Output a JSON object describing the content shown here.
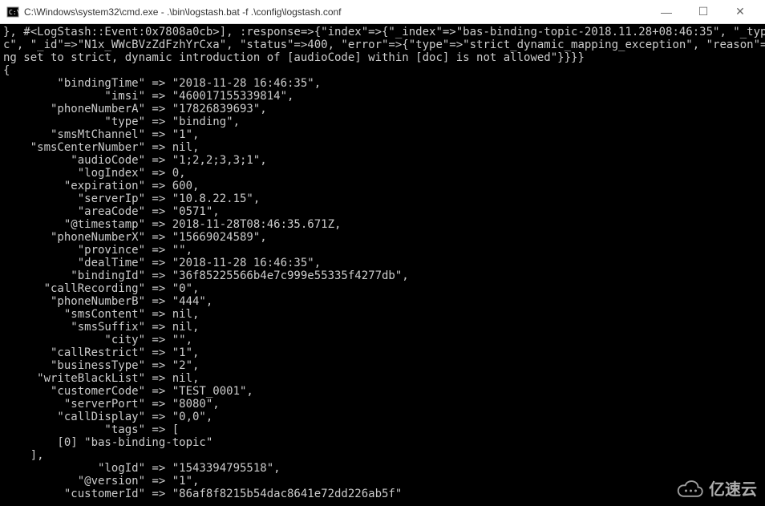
{
  "window": {
    "title": "C:\\Windows\\system32\\cmd.exe - .\\bin\\logstash.bat  -f .\\config\\logstash.conf",
    "minimize": "—",
    "maximize": "☐",
    "close": "✕"
  },
  "header_lines": [
    "}, #<LogStash::Event:0x7808a0cb>], :response=>{\"index\"=>{\"_index\"=>\"bas-binding-topic-2018.11.28+08:46:35\", \"_type\"=>\"do",
    "c\", \"_id\"=>\"N1x_WWcBVzZdFzhYrCxa\", \"status\"=>400, \"error\"=>{\"type\"=>\"strict_dynamic_mapping_exception\", \"reason\"=>\"mappi",
    "ng set to strict, dynamic introduction of [audioCode] within [doc] is not allowed\"}}}}",
    "{"
  ],
  "fields": [
    {
      "key": "\"bindingTime\"",
      "value": "\"2018-11-28 16:46:35\","
    },
    {
      "key": "\"imsi\"",
      "value": "\"460017155339814\","
    },
    {
      "key": "\"phoneNumberA\"",
      "value": "\"17826839693\","
    },
    {
      "key": "\"type\"",
      "value": "\"binding\","
    },
    {
      "key": "\"smsMtChannel\"",
      "value": "\"1\","
    },
    {
      "key": "\"smsCenterNumber\"",
      "value": "nil,"
    },
    {
      "key": "\"audioCode\"",
      "value": "\"1;2,2;3,3;1\","
    },
    {
      "key": "\"logIndex\"",
      "value": "0,"
    },
    {
      "key": "\"expiration\"",
      "value": "600,"
    },
    {
      "key": "\"serverIp\"",
      "value": "\"10.8.22.15\","
    },
    {
      "key": "\"areaCode\"",
      "value": "\"0571\","
    },
    {
      "key": "\"@timestamp\"",
      "value": "2018-11-28T08:46:35.671Z,"
    },
    {
      "key": "\"phoneNumberX\"",
      "value": "\"15669024589\","
    },
    {
      "key": "\"province\"",
      "value": "\"\","
    },
    {
      "key": "\"dealTime\"",
      "value": "\"2018-11-28 16:46:35\","
    },
    {
      "key": "\"bindingId\"",
      "value": "\"36f85225566b4e7c999e55335f4277db\","
    },
    {
      "key": "\"callRecording\"",
      "value": "\"0\","
    },
    {
      "key": "\"phoneNumberB\"",
      "value": "\"444\","
    },
    {
      "key": "\"smsContent\"",
      "value": "nil,"
    },
    {
      "key": "\"smsSuffix\"",
      "value": "nil,"
    },
    {
      "key": "\"city\"",
      "value": "\"\","
    },
    {
      "key": "\"callRestrict\"",
      "value": "\"1\","
    },
    {
      "key": "\"businessType\"",
      "value": "\"2\","
    },
    {
      "key": "\"writeBlackList\"",
      "value": "nil,"
    },
    {
      "key": "\"customerCode\"",
      "value": "\"TEST_0001\","
    },
    {
      "key": "\"serverPort\"",
      "value": "\"8080\","
    },
    {
      "key": "\"callDisplay\"",
      "value": "\"0,0\","
    },
    {
      "key": "\"tags\"",
      "value": "["
    }
  ],
  "tags_line": "        [0] \"bas-binding-topic\"",
  "tags_close": "    ],",
  "fields2": [
    {
      "key": "\"logId\"",
      "value": "\"1543394795518\","
    },
    {
      "key": "\"@version\"",
      "value": "\"1\","
    },
    {
      "key": "\"customerId\"",
      "value": "\"86af8f8215b54dac8641e72dd226ab5f\""
    }
  ],
  "watermark": "亿速云"
}
